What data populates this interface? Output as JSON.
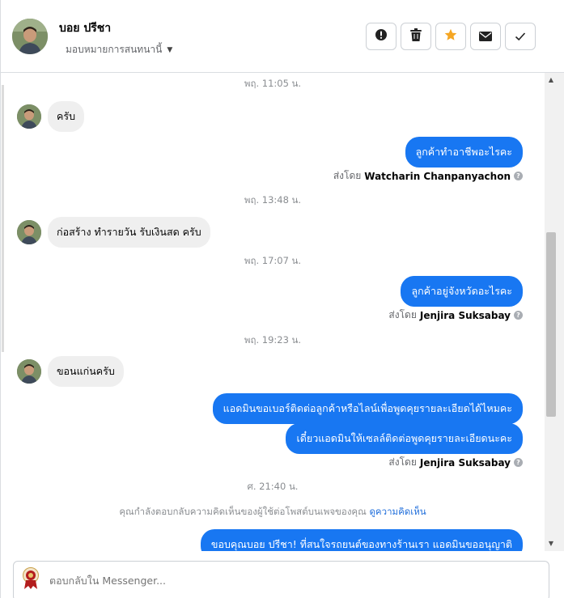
{
  "header": {
    "contact_name": "บอย ปรีชา",
    "assign_label": "มอบหมายการสนทนานี้",
    "actions": [
      {
        "name": "report-button",
        "icon": "alert-icon"
      },
      {
        "name": "delete-button",
        "icon": "trash-icon"
      },
      {
        "name": "star-button",
        "icon": "star-icon"
      },
      {
        "name": "mark-unread-button",
        "icon": "envelope-icon"
      },
      {
        "name": "done-button",
        "icon": "check-icon"
      }
    ]
  },
  "thread": {
    "ts1": "พฤ. 11:05 น.",
    "msg1": "ครับ",
    "msg2": "ลูกค้าทำอาชีพอะไรคะ",
    "sent_by_prefix": "ส่งโดย",
    "sender1": "Watcharin Chanpanyachon",
    "ts2": "พฤ. 13:48 น.",
    "msg3": "ก่อสร้าง ทำรายวัน รับเงินสด ครับ",
    "ts3": "พฤ. 17:07 น.",
    "msg4": "ลูกค้าอยู่จังหวัดอะไรคะ",
    "sender2": "Jenjira Suksabay",
    "ts4": "พฤ. 19:23 น.",
    "msg5": "ขอนแก่นครับ",
    "msg6": "แอดมินขอเบอร์ติดต่อลูกค้าหรือไลน์เพื่อพูดคุยรายละเอียดได้ไหมคะ",
    "msg7": "เดี๋ยวแอดมินให้เซลล์ติดต่อพูดคุยรายละเอียดนะคะ",
    "sender3": "Jenjira Suksabay",
    "ts5": "ศ. 21:40 น.",
    "note_text": "คุณกำลังตอบกลับความคิดเห็นของผู้ใช้ต่อโพสต์บนเพจของคุณ",
    "note_link": "ดูความคิดเห็น",
    "msg8": "ขอบคุณบอย ปรีชา! ที่สนใจรถยนต์ของทางร้านเรา แอดมินขออนุญาติ"
  },
  "composer": {
    "placeholder": "ตอบกลับใน Messenger..."
  },
  "colors": {
    "accent": "#1877f2",
    "star": "#f5a623",
    "incoming_bubble": "#efefef"
  }
}
